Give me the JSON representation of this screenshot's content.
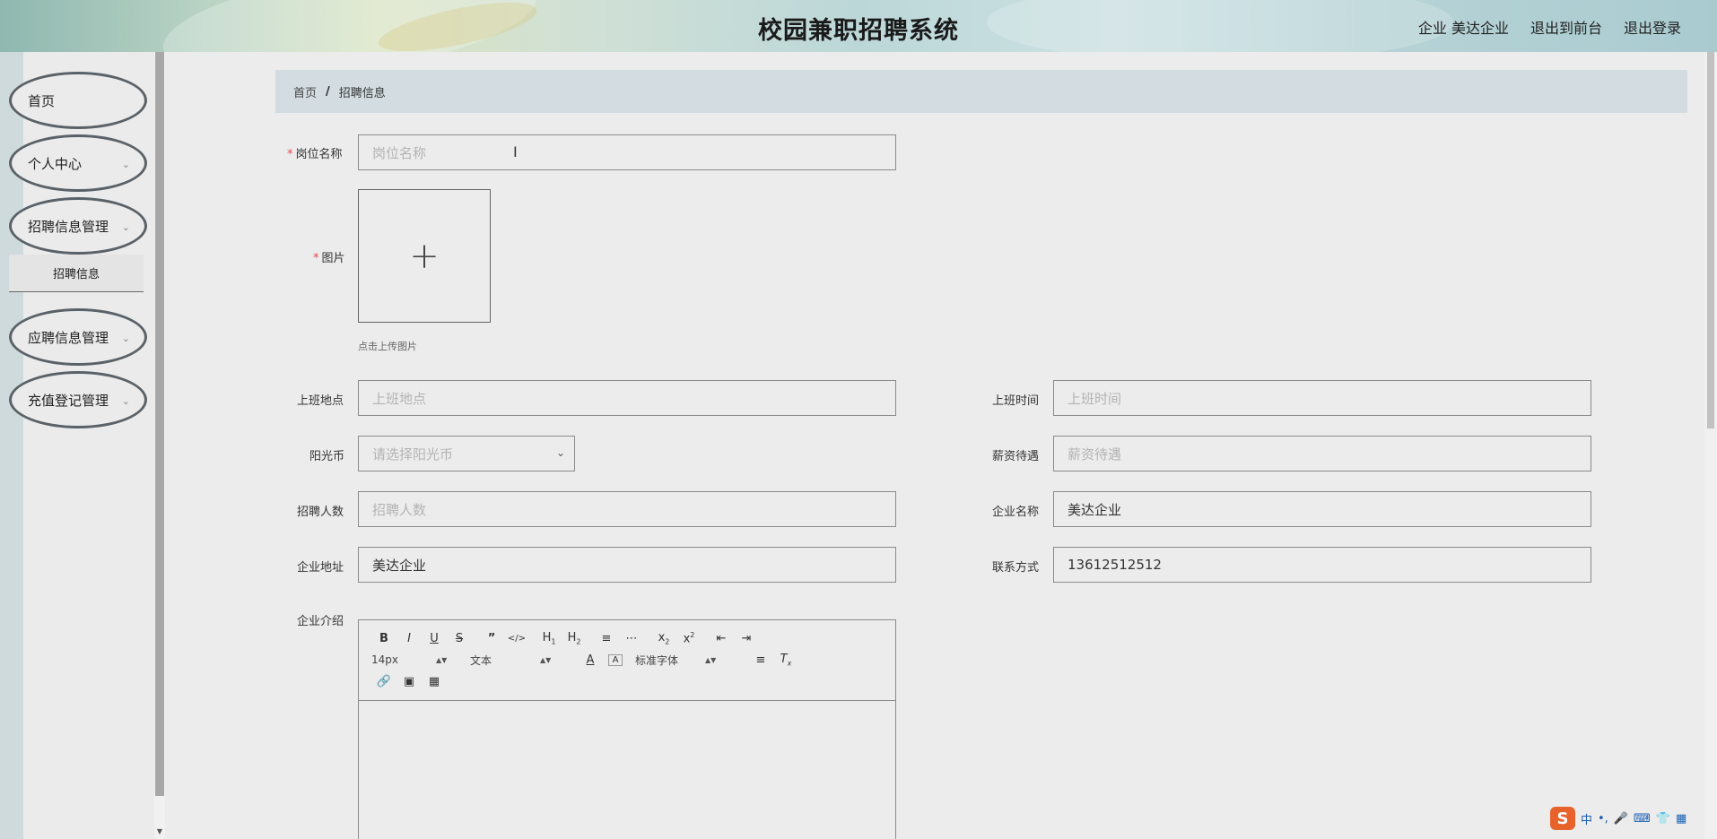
{
  "header": {
    "title": "校园兼职招聘系统",
    "user": "企业 美达企业",
    "to_front": "退出到前台",
    "logout": "退出登录"
  },
  "sidebar": {
    "items": [
      {
        "label": "首页",
        "expandable": false
      },
      {
        "label": "个人中心",
        "expandable": true
      },
      {
        "label": "招聘信息管理",
        "expandable": true
      },
      {
        "label": "应聘信息管理",
        "expandable": true
      },
      {
        "label": "充值登记管理",
        "expandable": true
      }
    ],
    "sub_item": "招聘信息"
  },
  "breadcrumb": {
    "home": "首页",
    "current": "招聘信息"
  },
  "form": {
    "job_name": {
      "label": "岗位名称",
      "placeholder": "岗位名称"
    },
    "image": {
      "label": "图片",
      "hint": "点击上传图片"
    },
    "location": {
      "label": "上班地点",
      "placeholder": "上班地点"
    },
    "work_time": {
      "label": "上班时间",
      "placeholder": "上班时间"
    },
    "coins": {
      "label": "阳光币",
      "placeholder": "请选择阳光币"
    },
    "salary": {
      "label": "薪资待遇",
      "placeholder": "薪资待遇"
    },
    "headcount": {
      "label": "招聘人数",
      "placeholder": "招聘人数"
    },
    "company_name": {
      "label": "企业名称",
      "value": "美达企业"
    },
    "company_address": {
      "label": "企业地址",
      "value": "美达企业"
    },
    "contact": {
      "label": "联系方式",
      "value": "13612512512"
    },
    "intro": {
      "label": "企业介绍"
    }
  },
  "editor": {
    "font_size": "14px",
    "block_type": "文本",
    "font_family": "标准字体"
  },
  "ime": {
    "mode": "中"
  },
  "colors": {
    "required": "#e0474e",
    "breadcrumb_bg": "#d3dde1",
    "page_bg": "#ececec"
  }
}
